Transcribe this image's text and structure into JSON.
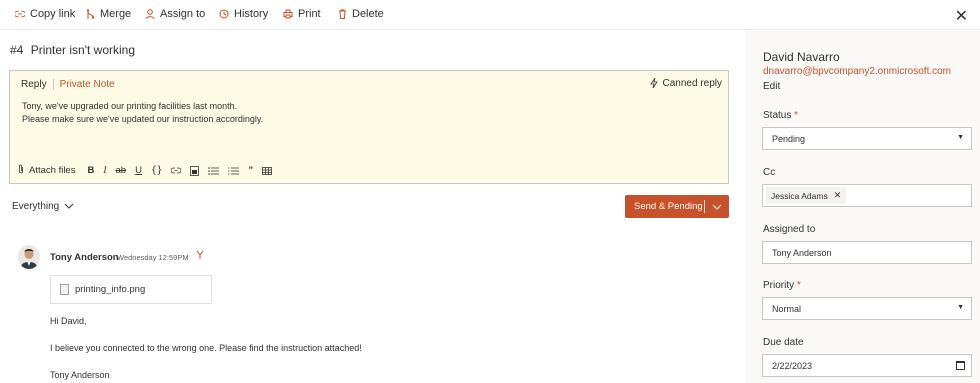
{
  "toolbar": {
    "copy_link": "Copy link",
    "merge": "Merge",
    "assign_to": "Assign to",
    "history": "History",
    "print": "Print",
    "delete": "Delete"
  },
  "ticket": {
    "number": "#4",
    "title": "Printer isn't working"
  },
  "editor": {
    "tab_reply": "Reply",
    "tab_private_note": "Private Note",
    "canned_reply": "Canned reply",
    "body_line1": "Tony, we've upgraded our printing facilities last month.",
    "body_line2": "Please make sure we've updated our instruction accordingly.",
    "attach_files": "Attach files"
  },
  "filter": {
    "label": "Everything"
  },
  "send_button": {
    "label": "Send & Pending"
  },
  "message": {
    "author": "Tony Anderson",
    "time": "Wednesday 12:59PM",
    "attachment": "printing_info.png",
    "greeting": "Hi David,",
    "body": "I believe you connected to the wrong one. Please find the instruction attached!",
    "signature": "Tony Anderson"
  },
  "sidebar": {
    "requester_name": "David Navarro",
    "requester_email": "dnavarro@bpvcompany2.onmicrosoft.com",
    "edit": "Edit",
    "status_label": "Status",
    "status_value": "Pending",
    "cc_label": "Cc",
    "cc_chip": "Jessica Adams",
    "assigned_label": "Assigned to",
    "assigned_value": "Tony Anderson",
    "priority_label": "Priority",
    "priority_value": "Normal",
    "due_label": "Due date",
    "due_value": "2/22/2023",
    "required_mark": "*"
  },
  "colors": {
    "accent": "#c7512a",
    "editor_bg": "#fdfbe6",
    "sidebar_bg": "#faf9f8"
  }
}
